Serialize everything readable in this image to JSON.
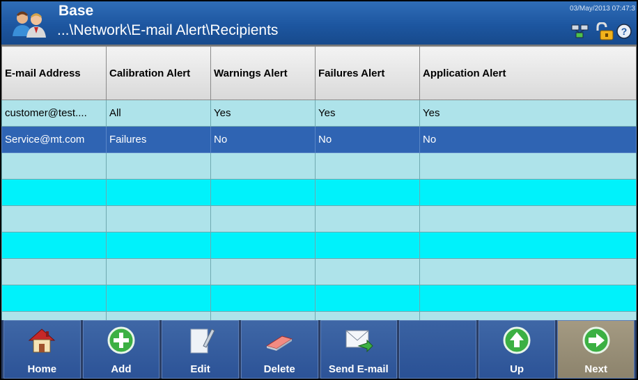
{
  "header": {
    "title": "Base",
    "path": "...\\Network\\E-mail Alert\\Recipients",
    "datetime": "03/May/2013 07:47:3",
    "icons": [
      "users-icon",
      "network-icon",
      "lock-icon",
      "help-icon"
    ]
  },
  "table": {
    "columns": [
      "E-mail Address",
      "Calibration Alert",
      "Warnings Alert",
      "Failures Alert",
      "Application Alert"
    ],
    "rows": [
      [
        "customer@test....",
        "All",
        "Yes",
        "Yes",
        "Yes"
      ],
      [
        "Service@mt.com",
        "Failures",
        "No",
        "No",
        "No"
      ]
    ],
    "selected_row": 1
  },
  "footer": {
    "buttons": [
      {
        "label": "Home",
        "icon": "home-icon"
      },
      {
        "label": "Add",
        "icon": "add-icon"
      },
      {
        "label": "Edit",
        "icon": "edit-icon"
      },
      {
        "label": "Delete",
        "icon": "eraser-icon"
      },
      {
        "label": "Send E-mail",
        "icon": "send-email-icon"
      },
      {
        "label": "",
        "icon": ""
      },
      {
        "label": "Up",
        "icon": "up-arrow-icon"
      },
      {
        "label": "Next",
        "icon": "next-arrow-icon"
      }
    ]
  },
  "colors": {
    "header": "#1d56a0",
    "row_light": "#aee3ea",
    "row_cyan": "#00f2fb",
    "row_selected": "#2f64b3",
    "footer_button": "#3f67a6",
    "next_button": "#a49a82"
  }
}
